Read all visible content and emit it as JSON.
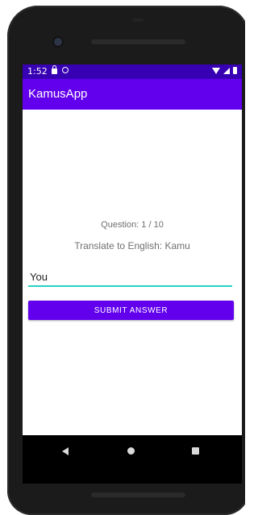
{
  "status_bar": {
    "time": "1:52",
    "left_icons": [
      "lock-icon",
      "sync-icon"
    ],
    "right_icons": [
      "wifi-icon",
      "signal-icon",
      "battery-icon"
    ]
  },
  "app_bar": {
    "title": "KamusApp"
  },
  "quiz": {
    "question_counter": "Question: 1 / 10",
    "prompt": "Translate to English: Kamu",
    "answer_value": "You",
    "submit_label": "SUBMIT ANSWER"
  },
  "nav_bar": {
    "buttons": [
      "back-icon",
      "home-icon",
      "recents-icon"
    ]
  },
  "colors": {
    "primary": "#6200ee",
    "primary_dark": "#3700b3",
    "accent": "#26d3c4"
  }
}
